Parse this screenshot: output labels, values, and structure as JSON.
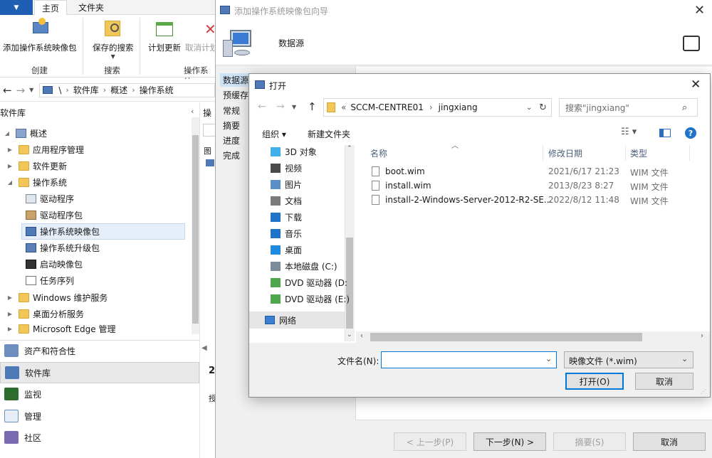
{
  "console": {
    "ribbon_tabs": {
      "home": "主页",
      "folder": "文件夹"
    },
    "ribbon_buttons": {
      "add_image": "添加操作系统映像包",
      "saved_search": "保存的搜索",
      "schedule_update": "计划更新",
      "cancel_schedule": "取消计划"
    },
    "ribbon_groups": {
      "create": "创建",
      "search": "搜索",
      "os": "操作系统"
    },
    "breadcrumb": [
      "\\",
      "软件库",
      "概述",
      "操作系统"
    ],
    "tree_header": "软件库",
    "tree": [
      {
        "label": "概述",
        "level": 0,
        "expanded": true
      },
      {
        "label": "应用程序管理",
        "level": 1
      },
      {
        "label": "软件更新",
        "level": 1
      },
      {
        "label": "操作系统",
        "level": 1,
        "expanded": true
      },
      {
        "label": "驱动程序",
        "level": 2
      },
      {
        "label": "驱动程序包",
        "level": 2
      },
      {
        "label": "操作系统映像包",
        "level": 2,
        "selected": true
      },
      {
        "label": "操作系统升级包",
        "level": 2
      },
      {
        "label": "启动映像包",
        "level": 2
      },
      {
        "label": "任务序列",
        "level": 2
      },
      {
        "label": "Windows 维护服务",
        "level": 1
      },
      {
        "label": "桌面分析服务",
        "level": 1
      },
      {
        "label": "Microsoft Edge 管理",
        "level": 1
      }
    ],
    "workspaces": [
      {
        "label": "资产和符合性"
      },
      {
        "label": "软件库",
        "selected": true
      },
      {
        "label": "监视"
      },
      {
        "label": "管理"
      },
      {
        "label": "社区"
      }
    ],
    "detail_strip": {
      "header": "操",
      "label1": "图",
      "label2": "2",
      "label3": "授"
    }
  },
  "wizard": {
    "title": "添加操作系统映像包向导",
    "header_title": "数据源",
    "steps": [
      "数据源",
      "预缓存",
      "常规",
      "摘要",
      "进度",
      "完成"
    ],
    "buttons": {
      "prev": "< 上一步(P)",
      "next": "下一步(N) >",
      "summary": "摘要(S)",
      "cancel": "取消"
    }
  },
  "open_dialog": {
    "title": "打开",
    "address": {
      "prefix": "«",
      "segments": [
        "SCCM-CENTRE01",
        "jingxiang"
      ]
    },
    "search_placeholder": "搜索\"jingxiang\"",
    "toolbar": {
      "organize": "组织 ▾",
      "new_folder": "新建文件夹"
    },
    "nav_items": [
      {
        "label": "3D 对象",
        "icon": "cube-icon",
        "color": "#3fb0e8"
      },
      {
        "label": "视频",
        "icon": "video-icon",
        "color": "#4a4a4a"
      },
      {
        "label": "图片",
        "icon": "pictures-icon",
        "color": "#5b8fc6"
      },
      {
        "label": "文档",
        "icon": "documents-icon",
        "color": "#7a7a7a"
      },
      {
        "label": "下载",
        "icon": "download-icon",
        "color": "#1f74c9"
      },
      {
        "label": "音乐",
        "icon": "music-icon",
        "color": "#1f74c9"
      },
      {
        "label": "桌面",
        "icon": "desktop-icon",
        "color": "#1f8be0"
      },
      {
        "label": "本地磁盘 (C:)",
        "icon": "drive-icon",
        "color": "#7b8b99"
      },
      {
        "label": "DVD 驱动器 (D:",
        "icon": "dvd-icon",
        "color": "#4ea64e"
      },
      {
        "label": "DVD 驱动器 (E:)",
        "icon": "dvd-icon",
        "color": "#4ea64e"
      }
    ],
    "network": "网络",
    "columns": {
      "name": "名称",
      "date": "修改日期",
      "type": "类型"
    },
    "files": [
      {
        "name": "boot.wim",
        "date": "2021/6/17 21:23",
        "type": "WIM 文件"
      },
      {
        "name": "install.wim",
        "date": "2013/8/23 8:27",
        "type": "WIM 文件"
      },
      {
        "name": "install-2-Windows-Server-2012-R2-SE...",
        "date": "2022/8/12 11:48",
        "type": "WIM 文件"
      }
    ],
    "filename_label": "文件名(N):",
    "filename_value": "",
    "filetype": "映像文件 (*.wim)",
    "open_btn": "打开(O)",
    "cancel_btn": "取消"
  }
}
